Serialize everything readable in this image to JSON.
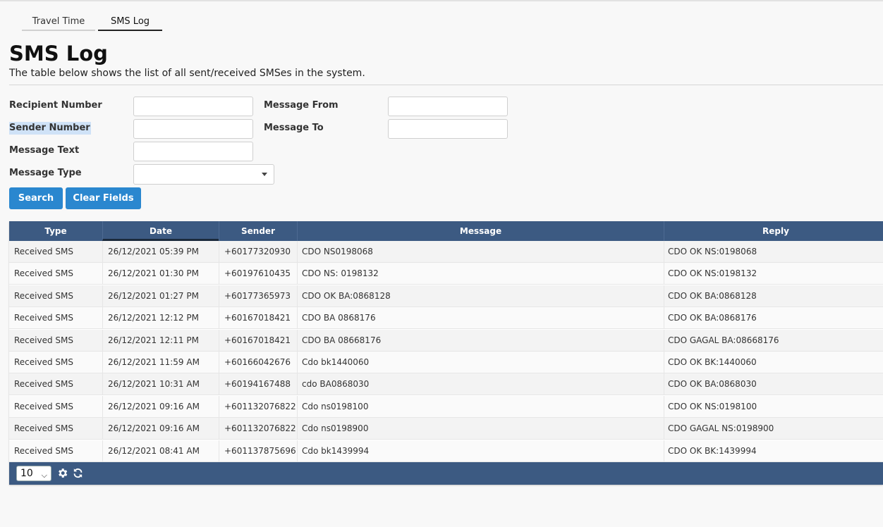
{
  "tabs": [
    {
      "label": "Travel Time",
      "active": false
    },
    {
      "label": "SMS Log",
      "active": true
    }
  ],
  "header": {
    "title": "SMS Log",
    "description": "The table below shows the list of all sent/received SMSes in the system."
  },
  "form": {
    "recipient_label": "Recipient Number",
    "sender_label": "Sender Number",
    "message_text_label": "Message Text",
    "message_type_label": "Message Type",
    "message_from_label": "Message From",
    "message_to_label": "Message To",
    "recipient_value": "",
    "sender_value": "",
    "message_text_value": "",
    "message_from_value": "",
    "message_to_value": "",
    "message_type_value": "",
    "search_label": "Search",
    "clear_label": "Clear Fields"
  },
  "grid": {
    "columns": [
      "Type",
      "Date",
      "Sender",
      "Message",
      "Reply"
    ],
    "sorted_column": "Date",
    "rows": [
      [
        "Received SMS",
        "26/12/2021 05:39 PM",
        "+60177320930",
        "CDO NS0198068",
        "CDO OK NS:0198068"
      ],
      [
        "Received SMS",
        "26/12/2021 01:30 PM",
        "+60197610435",
        "CDO NS: 0198132",
        "CDO OK NS:0198132"
      ],
      [
        "Received SMS",
        "26/12/2021 01:27 PM",
        "+60177365973",
        "CDO OK BA:0868128",
        "CDO OK BA:0868128"
      ],
      [
        "Received SMS",
        "26/12/2021 12:12 PM",
        "+60167018421",
        "CDO BA 0868176",
        "CDO OK BA:0868176"
      ],
      [
        "Received SMS",
        "26/12/2021 12:11 PM",
        "+60167018421",
        "CDO BA 08668176",
        "CDO GAGAL BA:08668176"
      ],
      [
        "Received SMS",
        "26/12/2021 11:59 AM",
        "+60166042676",
        "Cdo bk1440060",
        "CDO OK BK:1440060"
      ],
      [
        "Received SMS",
        "26/12/2021 10:31 AM",
        "+60194167488",
        "cdo BA0868030",
        "CDO OK BA:0868030"
      ],
      [
        "Received SMS",
        "26/12/2021 09:16 AM",
        "+601132076822",
        "Cdo ns0198100",
        "CDO OK NS:0198100"
      ],
      [
        "Received SMS",
        "26/12/2021 09:16 AM",
        "+601132076822",
        "Cdo ns0198900",
        "CDO GAGAL NS:0198900"
      ],
      [
        "Received SMS",
        "26/12/2021 08:41 AM",
        "+601137875696",
        "Cdo bk1439994",
        "CDO OK BK:1439994"
      ]
    ],
    "page_size": "10",
    "settings_icon": "gear-icon",
    "refresh_icon": "refresh-icon"
  },
  "colors": {
    "header_bg": "#3c5a82",
    "button_bg": "#2a87cf",
    "label_highlight": "#cfe2f7"
  }
}
